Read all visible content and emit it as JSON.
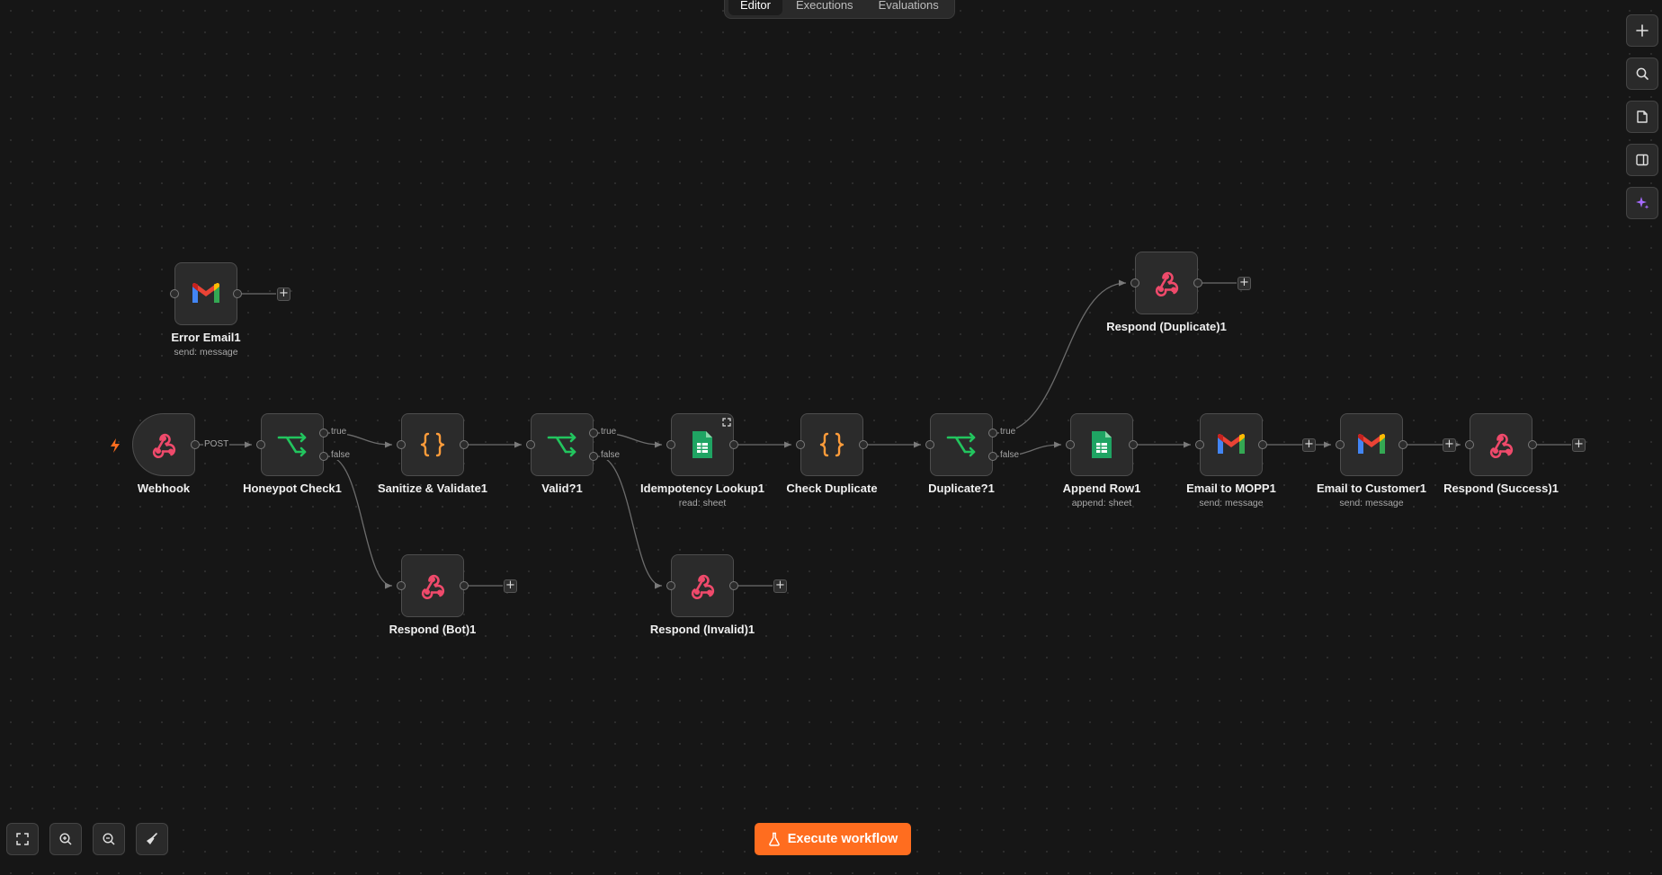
{
  "tabs": [
    {
      "label": "Editor",
      "active": true
    },
    {
      "label": "Executions",
      "active": false
    },
    {
      "label": "Evaluations",
      "active": false
    }
  ],
  "nodes": [
    {
      "id": "error-email",
      "label": "Error Email1",
      "sublabel": "send: message",
      "icon": "gmail-icon"
    },
    {
      "id": "webhook",
      "label": "Webhook",
      "sublabel": "",
      "icon": "webhook-icon"
    },
    {
      "id": "honeypot-check",
      "label": "Honeypot Check1",
      "sublabel": "",
      "icon": "if-branch-icon"
    },
    {
      "id": "sanitize-validate",
      "label": "Sanitize & Validate1",
      "sublabel": "",
      "icon": "code-braces-icon"
    },
    {
      "id": "valid",
      "label": "Valid?1",
      "sublabel": "",
      "icon": "if-branch-icon"
    },
    {
      "id": "idempotency-lookup",
      "label": "Idempotency Lookup1",
      "sublabel": "read: sheet",
      "icon": "google-sheets-icon"
    },
    {
      "id": "check-duplicate",
      "label": "Check Duplicate",
      "sublabel": "",
      "icon": "code-braces-icon"
    },
    {
      "id": "duplicate",
      "label": "Duplicate?1",
      "sublabel": "",
      "icon": "if-branch-icon"
    },
    {
      "id": "append-row",
      "label": "Append Row1",
      "sublabel": "append: sheet",
      "icon": "google-sheets-icon"
    },
    {
      "id": "email-to-mopp",
      "label": "Email to MOPP1",
      "sublabel": "send: message",
      "icon": "gmail-icon"
    },
    {
      "id": "email-to-customer",
      "label": "Email to Customer1",
      "sublabel": "send: message",
      "icon": "gmail-icon"
    },
    {
      "id": "respond-success",
      "label": "Respond (Success)1",
      "sublabel": "",
      "icon": "webhook-icon"
    },
    {
      "id": "respond-duplicate",
      "label": "Respond (Duplicate)1",
      "sublabel": "",
      "icon": "webhook-icon"
    },
    {
      "id": "respond-bot",
      "label": "Respond (Bot)1",
      "sublabel": "",
      "icon": "webhook-icon"
    },
    {
      "id": "respond-invalid",
      "label": "Respond (Invalid)1",
      "sublabel": "",
      "icon": "webhook-icon"
    }
  ],
  "edge_labels": {
    "post": "POST",
    "true": "true",
    "false": "false"
  },
  "right_toolbar": [
    {
      "name": "add-node-button",
      "icon": "plus-icon"
    },
    {
      "name": "search-nodes-button",
      "icon": "search-icon"
    },
    {
      "name": "sticky-note-button",
      "icon": "note-icon"
    },
    {
      "name": "toggle-panel-button",
      "icon": "panel-icon"
    },
    {
      "name": "ai-assistant-button",
      "icon": "sparkle-icon"
    }
  ],
  "bottom_toolbar": [
    {
      "name": "fit-view-button",
      "icon": "fit-view-icon"
    },
    {
      "name": "zoom-in-button",
      "icon": "zoom-in-icon"
    },
    {
      "name": "zoom-out-button",
      "icon": "zoom-out-icon"
    },
    {
      "name": "tidy-up-button",
      "icon": "broom-icon"
    }
  ],
  "execute_button": {
    "label": "Execute workflow",
    "icon": "flask-icon"
  },
  "colors": {
    "accent": "#ff6d1f",
    "webhook": "#ef4a6b",
    "if_branch": "#22c55e",
    "code": "#ff9c3a",
    "sheets": "#1fa463",
    "canvas": "#161616"
  }
}
